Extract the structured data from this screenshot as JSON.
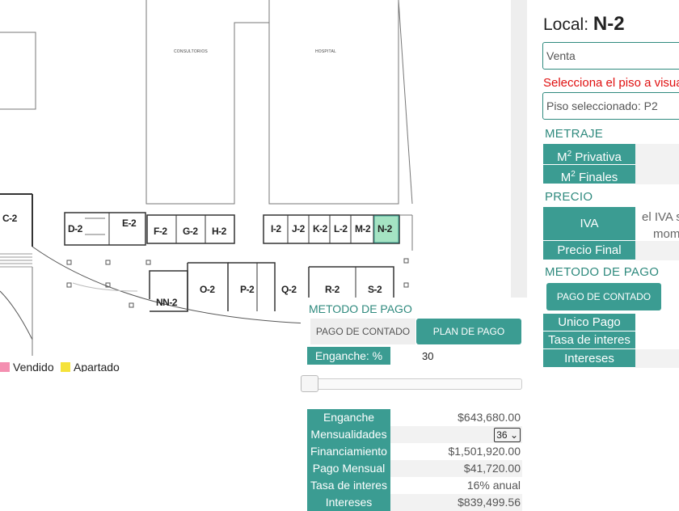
{
  "floorplan": {
    "building_labels": [
      "CONSULTORIOS",
      "HOSPITAL"
    ],
    "units": [
      {
        "id": "C-2"
      },
      {
        "id": "D-2"
      },
      {
        "id": "E-2"
      },
      {
        "id": "F-2"
      },
      {
        "id": "G-2"
      },
      {
        "id": "H-2"
      },
      {
        "id": "I-2"
      },
      {
        "id": "J-2"
      },
      {
        "id": "K-2"
      },
      {
        "id": "L-2"
      },
      {
        "id": "M-2"
      },
      {
        "id": "N-2"
      },
      {
        "id": "NN-2"
      },
      {
        "id": "O-2"
      },
      {
        "id": "P-2"
      },
      {
        "id": "Q-2"
      },
      {
        "id": "R-2"
      },
      {
        "id": "S-2"
      }
    ],
    "selected_unit": "N-2",
    "legend": [
      {
        "label": "Vendido",
        "color": "#f48fb1"
      },
      {
        "label": "Apartado",
        "color": "#f5e23a"
      }
    ]
  },
  "right_panel": {
    "title_prefix": "Local:",
    "title_unit": "N-2",
    "status_value": "Venta",
    "prompt": "Selecciona el piso a visua",
    "floor_selected": "Piso seleccionado: P2",
    "sections": {
      "metraje": "METRAJE",
      "precio": "PRECIO",
      "metodo": "METODO DE PAGO"
    },
    "labels": {
      "m2_privativa": "Privativa",
      "m2_finales": "Finales",
      "iva": "IVA",
      "precio_final": "Precio Final",
      "unico_pago": "Unico Pago",
      "tasa": "Tasa de interes",
      "intereses": "Intereses"
    },
    "iva_note_line1": "el IVA s",
    "iva_note_line2": "mom",
    "button_contado": "PAGO DE CONTADO"
  },
  "payment": {
    "section": "METODO DE PAGO",
    "tab_contado": "PAGO DE CONTADO",
    "tab_plan": "PLAN DE PAGO",
    "enganche_pct_label": "Enganche: %",
    "enganche_pct_value": "30",
    "slider_value_percent": 0,
    "rows": {
      "enganche_label": "Enganche",
      "enganche_value": "$643,680.00",
      "mensualidades_label": "Mensualidades",
      "mensualidades_value": "36",
      "financiamiento_label": "Financiamiento",
      "financiamiento_value": "$1,501,920.00",
      "pago_mensual_label": "Pago Mensual",
      "pago_mensual_value": "$41,720.00",
      "tasa_label": "Tasa de interes",
      "tasa_value": "16% anual",
      "intereses_label": "Intereses",
      "intereses_value": "$839,499.56"
    }
  },
  "colors": {
    "teal": "#3b9c92",
    "selected_unit": "#a5e3c3",
    "warning_text": "#e01010"
  }
}
